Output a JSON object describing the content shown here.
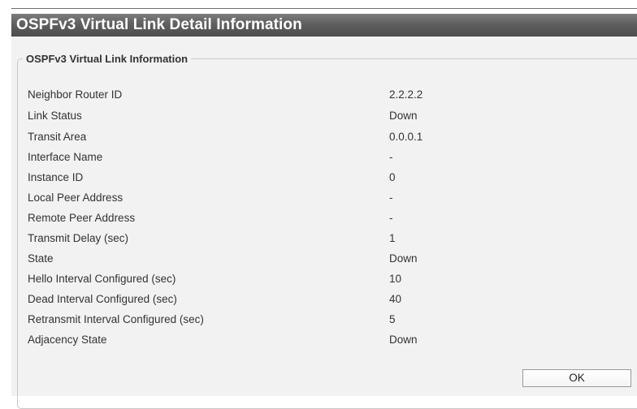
{
  "dialog": {
    "title": "OSPFv3 Virtual Link Detail Information",
    "section_title": "OSPFv3 Virtual Link Information",
    "rows": [
      {
        "label": "Neighbor Router ID",
        "value": "2.2.2.2"
      },
      {
        "label": "Link Status",
        "value": "Down"
      },
      {
        "label": "Transit Area",
        "value": "0.0.0.1"
      },
      {
        "label": "Interface Name",
        "value": "-"
      },
      {
        "label": "Instance ID",
        "value": "0"
      },
      {
        "label": "Local Peer Address",
        "value": "-"
      },
      {
        "label": "Remote Peer Address",
        "value": "-"
      },
      {
        "label": "Transmit Delay (sec)",
        "value": "1"
      },
      {
        "label": "State",
        "value": "Down"
      },
      {
        "label": "Hello Interval Configured (sec)",
        "value": "10"
      },
      {
        "label": "Dead Interval Configured (sec)",
        "value": "40"
      },
      {
        "label": "Retransmit Interval Configured (sec)",
        "value": "5"
      },
      {
        "label": "Adjacency State",
        "value": "Down"
      }
    ],
    "ok_label": "OK"
  },
  "colors": {
    "title_bar": "#5f5f5f",
    "content_background": "#f2f2f2",
    "text": "#333333"
  }
}
